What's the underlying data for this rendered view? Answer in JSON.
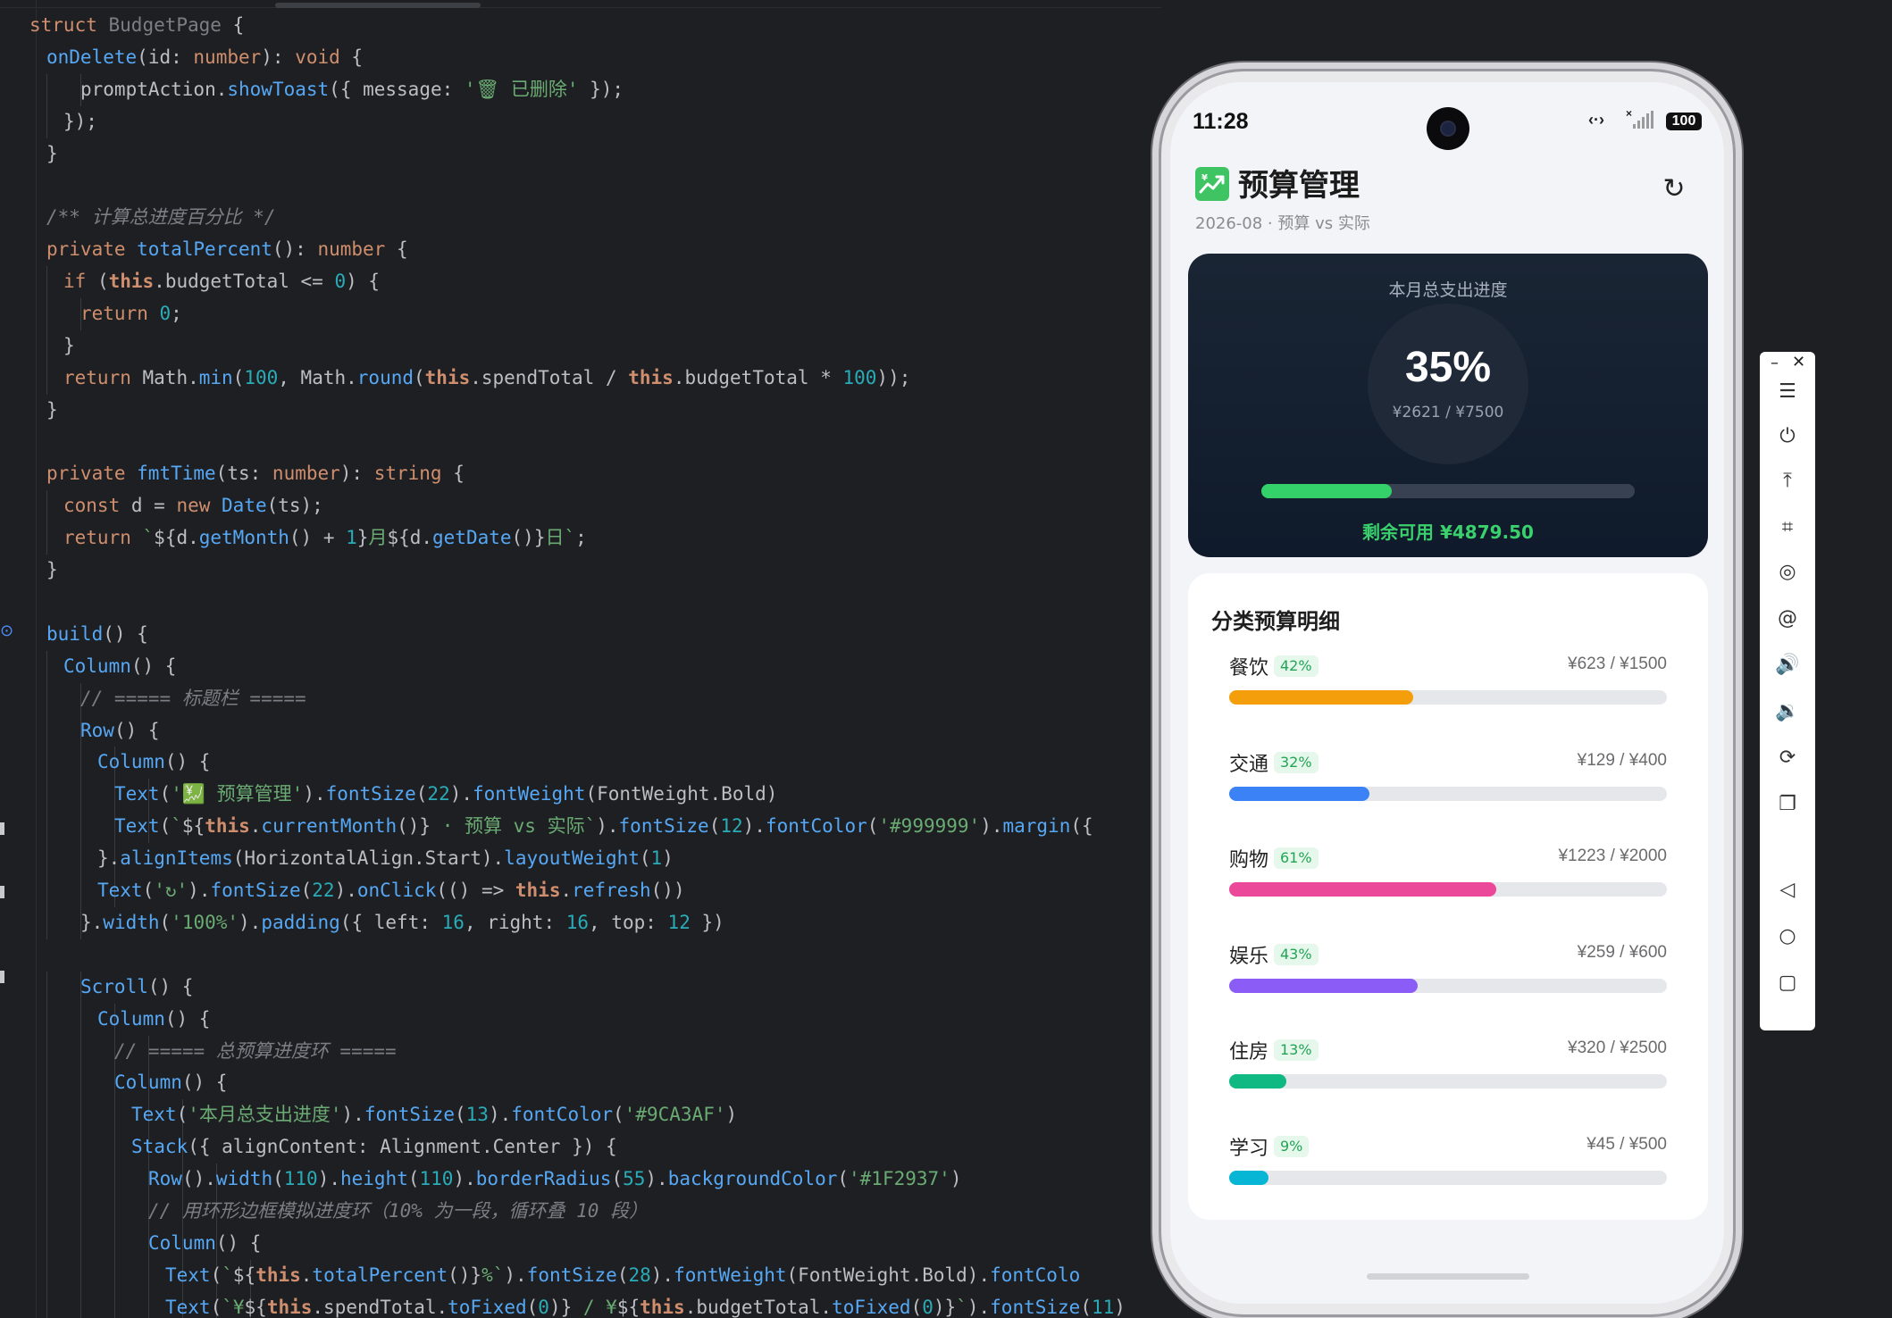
{
  "editor": {
    "lines": [
      {
        "indent": 0,
        "parts": [
          [
            "kw",
            "struct "
          ],
          [
            "cm2",
            "BudgetPage"
          ],
          [
            "op",
            " {"
          ]
        ]
      },
      {
        "indent": 1,
        "parts": [
          [
            "fn",
            "onDelete"
          ],
          [
            "op",
            "("
          ],
          [
            "tl",
            "id"
          ],
          [
            "op",
            ": "
          ],
          [
            "kw",
            "number"
          ],
          [
            "op",
            "): "
          ],
          [
            "kw",
            "void"
          ],
          [
            "op",
            " {"
          ]
        ]
      },
      {
        "indent": 3,
        "parts": [
          [
            "tl",
            "promptAction."
          ],
          [
            "fn",
            "showToast"
          ],
          [
            "op",
            "({ message: "
          ],
          [
            "st",
            "'🗑 已删除'"
          ],
          [
            "op",
            " });"
          ]
        ]
      },
      {
        "indent": 2,
        "parts": [
          [
            "op",
            "});"
          ]
        ]
      },
      {
        "indent": 1,
        "parts": [
          [
            "op",
            "}"
          ]
        ]
      },
      {
        "indent": 0,
        "parts": []
      },
      {
        "indent": 1,
        "parts": [
          [
            "cm",
            "/** 计算总进度百分比 */"
          ]
        ]
      },
      {
        "indent": 1,
        "parts": [
          [
            "kw",
            "private "
          ],
          [
            "fn",
            "totalPercent"
          ],
          [
            "op",
            "(): "
          ],
          [
            "kw",
            "number"
          ],
          [
            "op",
            " {"
          ]
        ]
      },
      {
        "indent": 2,
        "parts": [
          [
            "kw",
            "if "
          ],
          [
            "op",
            "("
          ],
          [
            "th",
            "this"
          ],
          [
            "op",
            ".budgetTotal <= "
          ],
          [
            "nm",
            "0"
          ],
          [
            "op",
            ") {"
          ]
        ]
      },
      {
        "indent": 3,
        "parts": [
          [
            "kw",
            "return "
          ],
          [
            "nm",
            "0"
          ],
          [
            "op",
            ";"
          ]
        ]
      },
      {
        "indent": 2,
        "parts": [
          [
            "op",
            "}"
          ]
        ]
      },
      {
        "indent": 2,
        "parts": [
          [
            "kw",
            "return "
          ],
          [
            "tl",
            "Math."
          ],
          [
            "fn",
            "min"
          ],
          [
            "op",
            "("
          ],
          [
            "nm",
            "100"
          ],
          [
            "op",
            ", Math."
          ],
          [
            "fn",
            "round"
          ],
          [
            "op",
            "("
          ],
          [
            "th",
            "this"
          ],
          [
            "op",
            ".spendTotal / "
          ],
          [
            "th",
            "this"
          ],
          [
            "op",
            ".budgetTotal * "
          ],
          [
            "nm",
            "100"
          ],
          [
            "op",
            "));"
          ]
        ]
      },
      {
        "indent": 1,
        "parts": [
          [
            "op",
            "}"
          ]
        ]
      },
      {
        "indent": 0,
        "parts": []
      },
      {
        "indent": 1,
        "parts": [
          [
            "kw",
            "private "
          ],
          [
            "fn",
            "fmtTime"
          ],
          [
            "op",
            "("
          ],
          [
            "tl",
            "ts"
          ],
          [
            "op",
            ": "
          ],
          [
            "kw",
            "number"
          ],
          [
            "op",
            "): "
          ],
          [
            "kw",
            "string"
          ],
          [
            "op",
            " {"
          ]
        ]
      },
      {
        "indent": 2,
        "parts": [
          [
            "kw",
            "const "
          ],
          [
            "tl",
            "d = "
          ],
          [
            "kw",
            "new "
          ],
          [
            "fn",
            "Date"
          ],
          [
            "op",
            "(ts);"
          ]
        ]
      },
      {
        "indent": 2,
        "parts": [
          [
            "kw",
            "return "
          ],
          [
            "st",
            "`"
          ],
          [
            "op",
            "${d."
          ],
          [
            "fn",
            "getMonth"
          ],
          [
            "op",
            "() + "
          ],
          [
            "nm",
            "1"
          ],
          [
            "op",
            "}"
          ],
          [
            "st",
            "月"
          ],
          [
            "op",
            "${d."
          ],
          [
            "fn",
            "getDate"
          ],
          [
            "op",
            "()}"
          ],
          [
            "st",
            "日`"
          ],
          [
            "op",
            ";"
          ]
        ]
      },
      {
        "indent": 1,
        "parts": [
          [
            "op",
            "}"
          ]
        ]
      },
      {
        "indent": 0,
        "parts": []
      },
      {
        "indent": 1,
        "parts": [
          [
            "fn",
            "build"
          ],
          [
            "op",
            "() {"
          ]
        ]
      },
      {
        "indent": 2,
        "parts": [
          [
            "fn",
            "Column"
          ],
          [
            "op",
            "() {"
          ]
        ]
      },
      {
        "indent": 3,
        "parts": [
          [
            "cm",
            "// ===== 标题栏 ====="
          ]
        ]
      },
      {
        "indent": 3,
        "parts": [
          [
            "fn",
            "Row"
          ],
          [
            "op",
            "() {"
          ]
        ]
      },
      {
        "indent": 4,
        "parts": [
          [
            "fn",
            "Column"
          ],
          [
            "op",
            "() {"
          ]
        ]
      },
      {
        "indent": 5,
        "parts": [
          [
            "fn",
            "Text"
          ],
          [
            "op",
            "("
          ],
          [
            "st",
            "'💹 预算管理'"
          ],
          [
            "op",
            ")."
          ],
          [
            "fn",
            "fontSize"
          ],
          [
            "op",
            "("
          ],
          [
            "nm",
            "22"
          ],
          [
            "op",
            ")."
          ],
          [
            "fn",
            "fontWeight"
          ],
          [
            "op",
            "(FontWeight.Bold)"
          ]
        ]
      },
      {
        "indent": 5,
        "parts": [
          [
            "fn",
            "Text"
          ],
          [
            "op",
            "("
          ],
          [
            "st",
            "`"
          ],
          [
            "op",
            "${"
          ],
          [
            "th",
            "this"
          ],
          [
            "op",
            "."
          ],
          [
            "fn",
            "currentMonth"
          ],
          [
            "op",
            "()}"
          ],
          [
            "st",
            " · 预算 vs 实际`"
          ],
          [
            "op",
            ")."
          ],
          [
            "fn",
            "fontSize"
          ],
          [
            "op",
            "("
          ],
          [
            "nm",
            "12"
          ],
          [
            "op",
            ")."
          ],
          [
            "fn",
            "fontColor"
          ],
          [
            "op",
            "("
          ],
          [
            "st",
            "'#999999'"
          ],
          [
            "op",
            ")."
          ],
          [
            "fn",
            "margin"
          ],
          [
            "op",
            "({"
          ]
        ]
      },
      {
        "indent": 4,
        "parts": [
          [
            "op",
            "}."
          ],
          [
            "fn",
            "alignItems"
          ],
          [
            "op",
            "(HorizontalAlign.Start)."
          ],
          [
            "fn",
            "layoutWeight"
          ],
          [
            "op",
            "("
          ],
          [
            "nm",
            "1"
          ],
          [
            "op",
            ")"
          ]
        ]
      },
      {
        "indent": 4,
        "parts": [
          [
            "fn",
            "Text"
          ],
          [
            "op",
            "("
          ],
          [
            "st",
            "'↻'"
          ],
          [
            "op",
            ")."
          ],
          [
            "fn",
            "fontSize"
          ],
          [
            "op",
            "("
          ],
          [
            "nm",
            "22"
          ],
          [
            "op",
            ")."
          ],
          [
            "fn",
            "onClick"
          ],
          [
            "op",
            "(() => "
          ],
          [
            "th",
            "this"
          ],
          [
            "op",
            "."
          ],
          [
            "fn",
            "refresh"
          ],
          [
            "op",
            "())"
          ]
        ]
      },
      {
        "indent": 3,
        "parts": [
          [
            "op",
            "}."
          ],
          [
            "fn",
            "width"
          ],
          [
            "op",
            "("
          ],
          [
            "st",
            "'100%'"
          ],
          [
            "op",
            ")."
          ],
          [
            "fn",
            "padding"
          ],
          [
            "op",
            "({ left: "
          ],
          [
            "nm",
            "16"
          ],
          [
            "op",
            ", right: "
          ],
          [
            "nm",
            "16"
          ],
          [
            "op",
            ", top: "
          ],
          [
            "nm",
            "12"
          ],
          [
            "op",
            " })"
          ]
        ]
      },
      {
        "indent": 0,
        "parts": []
      },
      {
        "indent": 3,
        "parts": [
          [
            "fn",
            "Scroll"
          ],
          [
            "op",
            "() {"
          ]
        ]
      },
      {
        "indent": 4,
        "parts": [
          [
            "fn",
            "Column"
          ],
          [
            "op",
            "() {"
          ]
        ]
      },
      {
        "indent": 5,
        "parts": [
          [
            "cm",
            "// ===== 总预算进度环 ====="
          ]
        ]
      },
      {
        "indent": 5,
        "parts": [
          [
            "fn",
            "Column"
          ],
          [
            "op",
            "() {"
          ]
        ]
      },
      {
        "indent": 6,
        "parts": [
          [
            "fn",
            "Text"
          ],
          [
            "op",
            "("
          ],
          [
            "st",
            "'本月总支出进度'"
          ],
          [
            "op",
            ")."
          ],
          [
            "fn",
            "fontSize"
          ],
          [
            "op",
            "("
          ],
          [
            "nm",
            "13"
          ],
          [
            "op",
            ")."
          ],
          [
            "fn",
            "fontColor"
          ],
          [
            "op",
            "("
          ],
          [
            "st",
            "'#9CA3AF'"
          ],
          [
            "op",
            ")"
          ]
        ]
      },
      {
        "indent": 6,
        "parts": [
          [
            "fn",
            "Stack"
          ],
          [
            "op",
            "({ alignContent: Alignment.Center }) {"
          ]
        ]
      },
      {
        "indent": 7,
        "parts": [
          [
            "fn",
            "Row"
          ],
          [
            "op",
            "()."
          ],
          [
            "fn",
            "width"
          ],
          [
            "op",
            "("
          ],
          [
            "nm",
            "110"
          ],
          [
            "op",
            ")."
          ],
          [
            "fn",
            "height"
          ],
          [
            "op",
            "("
          ],
          [
            "nm",
            "110"
          ],
          [
            "op",
            ")."
          ],
          [
            "fn",
            "borderRadius"
          ],
          [
            "op",
            "("
          ],
          [
            "nm",
            "55"
          ],
          [
            "op",
            ")."
          ],
          [
            "fn",
            "backgroundColor"
          ],
          [
            "op",
            "("
          ],
          [
            "st",
            "'#1F2937'"
          ],
          [
            "op",
            ")"
          ]
        ]
      },
      {
        "indent": 7,
        "parts": [
          [
            "cm",
            "// 用环形边框模拟进度环（10% 为一段，循环叠 10 段）"
          ]
        ]
      },
      {
        "indent": 7,
        "parts": [
          [
            "fn",
            "Column"
          ],
          [
            "op",
            "() {"
          ]
        ]
      },
      {
        "indent": 8,
        "parts": [
          [
            "fn",
            "Text"
          ],
          [
            "op",
            "("
          ],
          [
            "st",
            "`"
          ],
          [
            "op",
            "${"
          ],
          [
            "th",
            "this"
          ],
          [
            "op",
            "."
          ],
          [
            "fn",
            "totalPercent"
          ],
          [
            "op",
            "()}"
          ],
          [
            "st",
            "%`"
          ],
          [
            "op",
            ")."
          ],
          [
            "fn",
            "fontSize"
          ],
          [
            "op",
            "("
          ],
          [
            "nm",
            "28"
          ],
          [
            "op",
            ")."
          ],
          [
            "fn",
            "fontWeight"
          ],
          [
            "op",
            "(FontWeight.Bold)."
          ],
          [
            "fn",
            "fontColo"
          ]
        ]
      },
      {
        "indent": 8,
        "parts": [
          [
            "fn",
            "Text"
          ],
          [
            "op",
            "("
          ],
          [
            "st",
            "`¥"
          ],
          [
            "op",
            "${"
          ],
          [
            "th",
            "this"
          ],
          [
            "op",
            ".spendTotal."
          ],
          [
            "fn",
            "toFixed"
          ],
          [
            "op",
            "("
          ],
          [
            "nm",
            "0"
          ],
          [
            "op",
            ")}"
          ],
          [
            "st",
            " / ¥"
          ],
          [
            "op",
            "${"
          ],
          [
            "th",
            "this"
          ],
          [
            "op",
            ".budgetTotal."
          ],
          [
            "fn",
            "toFixed"
          ],
          [
            "op",
            "("
          ],
          [
            "nm",
            "0"
          ],
          [
            "op",
            ")}"
          ],
          [
            "st",
            "`"
          ],
          [
            "op",
            ")."
          ],
          [
            "fn",
            "fontSize"
          ],
          [
            "op",
            "("
          ],
          [
            "nm",
            "11"
          ],
          [
            "op",
            ")"
          ]
        ]
      }
    ]
  },
  "phone": {
    "status": {
      "time": "11:28",
      "battery": "100"
    },
    "header": {
      "title": "预算管理",
      "subtitle": "2026-08 · 预算 vs 实际",
      "refresh_icon": "↻"
    },
    "summary": {
      "title": "本月总支出进度",
      "percent_text": "35%",
      "percent": 35,
      "ratio": "¥2621 / ¥7500",
      "remaining": "剩余可用 ¥4879.50",
      "bar_color": "#34d06a"
    },
    "detail": {
      "title": "分类预算明细",
      "categories": [
        {
          "name": "餐饮",
          "badge": "42%",
          "percent": 42,
          "amount": "¥623 / ¥1500",
          "color": "#f59e0b"
        },
        {
          "name": "交通",
          "badge": "32%",
          "percent": 32,
          "amount": "¥129 / ¥400",
          "color": "#3b82f6"
        },
        {
          "name": "购物",
          "badge": "61%",
          "percent": 61,
          "amount": "¥1223 / ¥2000",
          "color": "#ec4899"
        },
        {
          "name": "娱乐",
          "badge": "43%",
          "percent": 43,
          "amount": "¥259 / ¥600",
          "color": "#8b5cf6"
        },
        {
          "name": "住房",
          "badge": "13%",
          "percent": 13,
          "amount": "¥320 / ¥2500",
          "color": "#10b981"
        },
        {
          "name": "学习",
          "badge": "9%",
          "percent": 9,
          "amount": "¥45 / ¥500",
          "color": "#06b6d4"
        }
      ]
    }
  },
  "toolbar": {
    "minimize": "–",
    "close": "✕",
    "icons": [
      "menu-icon",
      "power-icon",
      "pin-top-icon",
      "crop-icon",
      "target-icon",
      "at-icon",
      "volume-up-icon",
      "volume-down-icon",
      "rotate-icon",
      "screens-icon",
      "back-icon",
      "home-icon",
      "recent-icon"
    ],
    "glyphs": [
      "☰",
      "⏻",
      "⤒",
      "⌗",
      "◎",
      "@",
      "🔊",
      "🔉",
      "⟳",
      "❐",
      "◁",
      "○",
      "▢"
    ]
  }
}
